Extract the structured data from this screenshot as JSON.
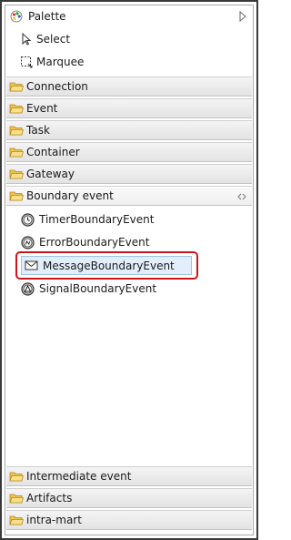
{
  "palette": {
    "title": "Palette",
    "tools": [
      {
        "label": "Select",
        "icon": "arrow-cursor-icon"
      },
      {
        "label": "Marquee",
        "icon": "marquee-icon"
      }
    ],
    "drawers_top": [
      {
        "label": "Connection"
      },
      {
        "label": "Event"
      },
      {
        "label": "Task"
      },
      {
        "label": "Container"
      },
      {
        "label": "Gateway"
      }
    ],
    "open_drawer": {
      "label": "Boundary event",
      "entries": [
        {
          "label": "TimerBoundaryEvent",
          "icon": "timer-event-icon"
        },
        {
          "label": "ErrorBoundaryEvent",
          "icon": "error-event-icon"
        },
        {
          "label": "MessageBoundaryEvent",
          "icon": "envelope-icon"
        },
        {
          "label": "SignalBoundaryEvent",
          "icon": "signal-event-icon"
        }
      ]
    },
    "drawers_bottom": [
      {
        "label": "Intermediate event"
      },
      {
        "label": "Artifacts"
      },
      {
        "label": "intra-mart"
      }
    ],
    "colors": {
      "highlight": "#c8161b",
      "selection": "#e3eefb",
      "folder": "#f2c24e"
    }
  }
}
